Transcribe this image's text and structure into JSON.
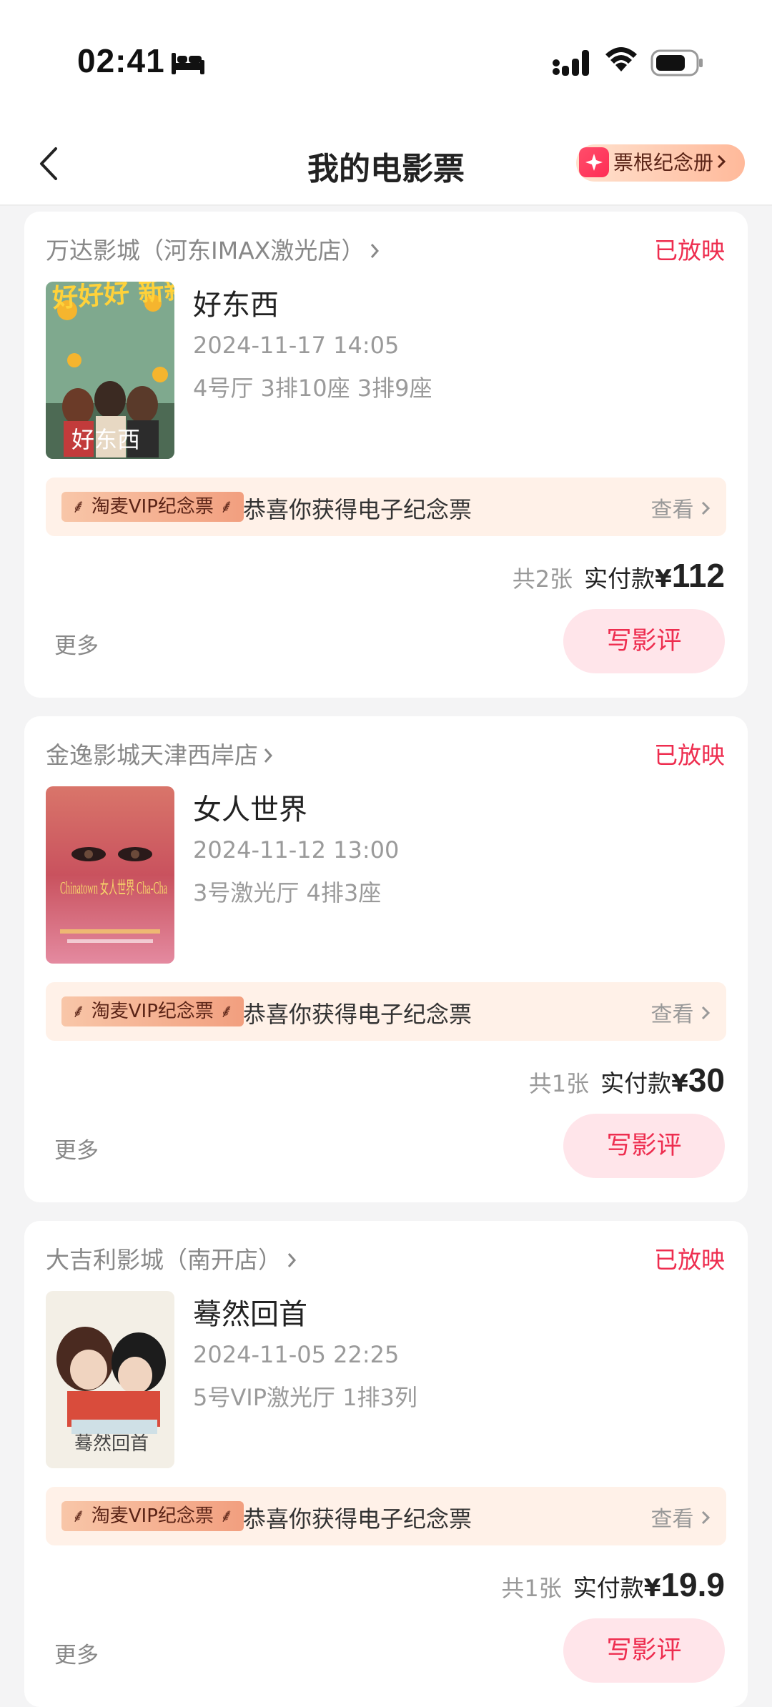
{
  "status_bar": {
    "time": "02:41"
  },
  "nav": {
    "title": "我的电影票",
    "album_button": "票根纪念册"
  },
  "tickets": [
    {
      "cinema": "万达影城（河东IMAX激光店）",
      "status": "已放映",
      "movie": "好东西",
      "showtime": "2024-11-17 14:05",
      "seats": "4号厅 3排10座 3排9座",
      "poster_text": "好好好 新新新",
      "poster_caption": "好东西",
      "vip_badge": "淘麦VIP纪念票",
      "vip_message": "恭喜你获得电子纪念票",
      "view_label": "查看",
      "count": "共2张",
      "paid_label": "实付款",
      "currency": "¥",
      "amount": "112",
      "more_label": "更多",
      "review_label": "写影评"
    },
    {
      "cinema": "金逸影城天津西岸店",
      "status": "已放映",
      "movie": "女人世界",
      "showtime": "2024-11-12 13:00",
      "seats": "3号激光厅 4排3座",
      "poster_text": "Chinatown 女人世界 Cha-Cha",
      "vip_badge": "淘麦VIP纪念票",
      "vip_message": "恭喜你获得电子纪念票",
      "view_label": "查看",
      "count": "共1张",
      "paid_label": "实付款",
      "currency": "¥",
      "amount": "30",
      "more_label": "更多",
      "review_label": "写影评"
    },
    {
      "cinema": "大吉利影城（南开店）",
      "status": "已放映",
      "movie": "蓦然回首",
      "showtime": "2024-11-05 22:25",
      "seats": "5号VIP激光厅 1排3列",
      "poster_text": "蓦然回首",
      "vip_badge": "淘麦VIP纪念票",
      "vip_message": "恭喜你获得电子纪念票",
      "view_label": "查看",
      "count": "共1张",
      "paid_label": "实付款",
      "currency": "¥",
      "amount": "19.9",
      "more_label": "更多",
      "review_label": "写影评"
    }
  ]
}
